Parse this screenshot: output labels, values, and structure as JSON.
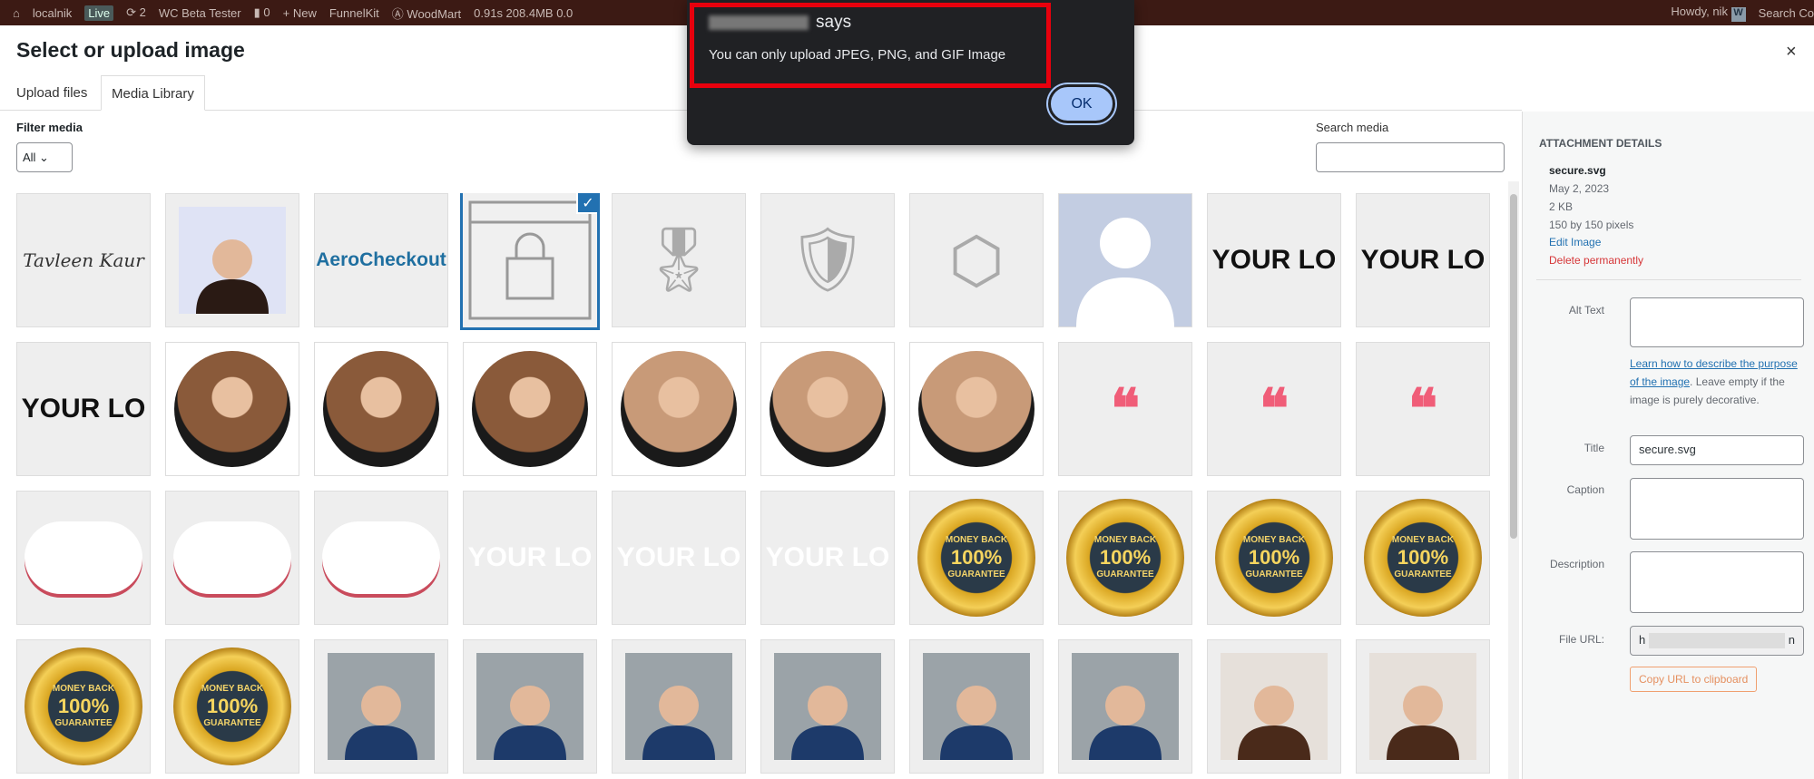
{
  "adminbar": {
    "site": "localnik",
    "live": "Live",
    "updates": "2",
    "beta": "WC Beta Tester",
    "comments": "0",
    "new": "New",
    "funnelkit": "FunnelKit",
    "woodmart": "WoodMart",
    "perf": "0.91s 208.4MB 0.0",
    "howdy": "Howdy, nik",
    "search": "Search Co"
  },
  "modal": {
    "title": "Select or upload image",
    "close": "×",
    "tabs": [
      {
        "label": "Upload files"
      },
      {
        "label": "Media Library"
      }
    ],
    "filter_label": "Filter media",
    "filter_value": "All ⌄",
    "search_label": "Search media",
    "search_value": ""
  },
  "tiles": [
    {
      "t": "script",
      "text": "Tavleen Kaur"
    },
    {
      "t": "photo",
      "c": "#dfe3f5",
      "f": "#2a1a14"
    },
    {
      "t": "aero",
      "text": "AeroCheckout"
    },
    {
      "t": "lock",
      "sel": true
    },
    {
      "t": "glyph",
      "text": "🎖"
    },
    {
      "t": "glyph",
      "text": "🛡"
    },
    {
      "t": "glyph",
      "text": "⬡"
    },
    {
      "t": "avatar"
    },
    {
      "t": "logo",
      "text": "YOUR LO"
    },
    {
      "t": "logo",
      "text": "YOUR LO"
    },
    {
      "t": "logo",
      "text": "YOUR LO"
    },
    {
      "t": "circ",
      "c": "#8a5a3a"
    },
    {
      "t": "circ",
      "c": "#8a5a3a"
    },
    {
      "t": "circ",
      "c": "#8a5a3a"
    },
    {
      "t": "circ",
      "c": "#c89a78"
    },
    {
      "t": "circ",
      "c": "#c89a78"
    },
    {
      "t": "circ",
      "c": "#c89a78"
    },
    {
      "t": "quote",
      "text": "❝"
    },
    {
      "t": "quote",
      "text": "❝"
    },
    {
      "t": "quote",
      "text": "❝"
    },
    {
      "t": "cloud"
    },
    {
      "t": "cloud"
    },
    {
      "t": "cloud"
    },
    {
      "t": "logow",
      "text": "YOUR LO"
    },
    {
      "t": "logow",
      "text": "YOUR LO"
    },
    {
      "t": "logow",
      "text": "YOUR LO"
    },
    {
      "t": "badge",
      "a": "MONEY BACK",
      "b": "100%",
      "c": "GUARANTEE"
    },
    {
      "t": "badge",
      "a": "MONEY BACK",
      "b": "100%",
      "c": "GUARANTEE"
    },
    {
      "t": "badge",
      "a": "MONEY BACK",
      "b": "100%",
      "c": "GUARANTEE"
    },
    {
      "t": "badge",
      "a": "MONEY BACK",
      "b": "100%",
      "c": "GUARANTEE"
    },
    {
      "t": "badge",
      "a": "MONEY BACK",
      "b": "100%",
      "c": "GUARANTEE"
    },
    {
      "t": "badge",
      "a": "MONEY BACK",
      "b": "100%",
      "c": "GUARANTEE"
    },
    {
      "t": "photo",
      "c": "#9ba3a8",
      "f": "#1d3a6a"
    },
    {
      "t": "photo",
      "c": "#9ba3a8",
      "f": "#1d3a6a"
    },
    {
      "t": "photo",
      "c": "#9ba3a8",
      "f": "#1d3a6a"
    },
    {
      "t": "photo",
      "c": "#9ba3a8",
      "f": "#1d3a6a"
    },
    {
      "t": "photo",
      "c": "#9ba3a8",
      "f": "#1d3a6a"
    },
    {
      "t": "photo",
      "c": "#9ba3a8",
      "f": "#1d3a6a"
    },
    {
      "t": "photo",
      "c": "#e6e0da",
      "f": "#4a2a1a"
    },
    {
      "t": "photo",
      "c": "#e6e0da",
      "f": "#4a2a1a"
    }
  ],
  "details": {
    "heading": "ATTACHMENT DETAILS",
    "filename": "secure.svg",
    "date": "May 2, 2023",
    "size": "2 KB",
    "dimensions": "150 by 150 pixels",
    "edit": "Edit Image",
    "delete": "Delete permanently",
    "alt_label": "Alt Text",
    "alt_value": "",
    "alt_help_link": "Learn how to describe the purpose of the image",
    "alt_help_text": ". Leave empty if the image is purely decorative.",
    "title_label": "Title",
    "title_value": "secure.svg",
    "caption_label": "Caption",
    "description_label": "Description",
    "url_label": "File URL:",
    "url_start": "h",
    "url_end": "n",
    "copy": "Copy URL to clipboard"
  },
  "dialog": {
    "says": "says",
    "message": "You can only upload JPEG, PNG, and GIF Image",
    "ok": "OK",
    "highlight_color": "#e8000d"
  }
}
